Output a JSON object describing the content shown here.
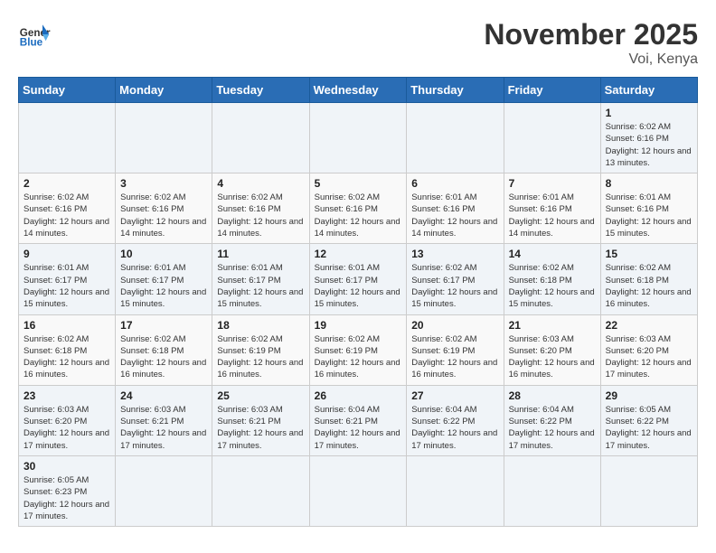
{
  "header": {
    "logo_general": "General",
    "logo_blue": "Blue",
    "month_title": "November 2025",
    "location": "Voi, Kenya"
  },
  "days_of_week": [
    "Sunday",
    "Monday",
    "Tuesday",
    "Wednesday",
    "Thursday",
    "Friday",
    "Saturday"
  ],
  "weeks": [
    [
      {
        "day": "",
        "info": ""
      },
      {
        "day": "",
        "info": ""
      },
      {
        "day": "",
        "info": ""
      },
      {
        "day": "",
        "info": ""
      },
      {
        "day": "",
        "info": ""
      },
      {
        "day": "",
        "info": ""
      },
      {
        "day": "1",
        "info": "Sunrise: 6:02 AM\nSunset: 6:16 PM\nDaylight: 12 hours and 13 minutes."
      }
    ],
    [
      {
        "day": "2",
        "info": "Sunrise: 6:02 AM\nSunset: 6:16 PM\nDaylight: 12 hours and 14 minutes."
      },
      {
        "day": "3",
        "info": "Sunrise: 6:02 AM\nSunset: 6:16 PM\nDaylight: 12 hours and 14 minutes."
      },
      {
        "day": "4",
        "info": "Sunrise: 6:02 AM\nSunset: 6:16 PM\nDaylight: 12 hours and 14 minutes."
      },
      {
        "day": "5",
        "info": "Sunrise: 6:02 AM\nSunset: 6:16 PM\nDaylight: 12 hours and 14 minutes."
      },
      {
        "day": "6",
        "info": "Sunrise: 6:01 AM\nSunset: 6:16 PM\nDaylight: 12 hours and 14 minutes."
      },
      {
        "day": "7",
        "info": "Sunrise: 6:01 AM\nSunset: 6:16 PM\nDaylight: 12 hours and 14 minutes."
      },
      {
        "day": "8",
        "info": "Sunrise: 6:01 AM\nSunset: 6:16 PM\nDaylight: 12 hours and 15 minutes."
      }
    ],
    [
      {
        "day": "9",
        "info": "Sunrise: 6:01 AM\nSunset: 6:17 PM\nDaylight: 12 hours and 15 minutes."
      },
      {
        "day": "10",
        "info": "Sunrise: 6:01 AM\nSunset: 6:17 PM\nDaylight: 12 hours and 15 minutes."
      },
      {
        "day": "11",
        "info": "Sunrise: 6:01 AM\nSunset: 6:17 PM\nDaylight: 12 hours and 15 minutes."
      },
      {
        "day": "12",
        "info": "Sunrise: 6:01 AM\nSunset: 6:17 PM\nDaylight: 12 hours and 15 minutes."
      },
      {
        "day": "13",
        "info": "Sunrise: 6:02 AM\nSunset: 6:17 PM\nDaylight: 12 hours and 15 minutes."
      },
      {
        "day": "14",
        "info": "Sunrise: 6:02 AM\nSunset: 6:18 PM\nDaylight: 12 hours and 15 minutes."
      },
      {
        "day": "15",
        "info": "Sunrise: 6:02 AM\nSunset: 6:18 PM\nDaylight: 12 hours and 16 minutes."
      }
    ],
    [
      {
        "day": "16",
        "info": "Sunrise: 6:02 AM\nSunset: 6:18 PM\nDaylight: 12 hours and 16 minutes."
      },
      {
        "day": "17",
        "info": "Sunrise: 6:02 AM\nSunset: 6:18 PM\nDaylight: 12 hours and 16 minutes."
      },
      {
        "day": "18",
        "info": "Sunrise: 6:02 AM\nSunset: 6:19 PM\nDaylight: 12 hours and 16 minutes."
      },
      {
        "day": "19",
        "info": "Sunrise: 6:02 AM\nSunset: 6:19 PM\nDaylight: 12 hours and 16 minutes."
      },
      {
        "day": "20",
        "info": "Sunrise: 6:02 AM\nSunset: 6:19 PM\nDaylight: 12 hours and 16 minutes."
      },
      {
        "day": "21",
        "info": "Sunrise: 6:03 AM\nSunset: 6:20 PM\nDaylight: 12 hours and 16 minutes."
      },
      {
        "day": "22",
        "info": "Sunrise: 6:03 AM\nSunset: 6:20 PM\nDaylight: 12 hours and 17 minutes."
      }
    ],
    [
      {
        "day": "23",
        "info": "Sunrise: 6:03 AM\nSunset: 6:20 PM\nDaylight: 12 hours and 17 minutes."
      },
      {
        "day": "24",
        "info": "Sunrise: 6:03 AM\nSunset: 6:21 PM\nDaylight: 12 hours and 17 minutes."
      },
      {
        "day": "25",
        "info": "Sunrise: 6:03 AM\nSunset: 6:21 PM\nDaylight: 12 hours and 17 minutes."
      },
      {
        "day": "26",
        "info": "Sunrise: 6:04 AM\nSunset: 6:21 PM\nDaylight: 12 hours and 17 minutes."
      },
      {
        "day": "27",
        "info": "Sunrise: 6:04 AM\nSunset: 6:22 PM\nDaylight: 12 hours and 17 minutes."
      },
      {
        "day": "28",
        "info": "Sunrise: 6:04 AM\nSunset: 6:22 PM\nDaylight: 12 hours and 17 minutes."
      },
      {
        "day": "29",
        "info": "Sunrise: 6:05 AM\nSunset: 6:22 PM\nDaylight: 12 hours and 17 minutes."
      }
    ],
    [
      {
        "day": "30",
        "info": "Sunrise: 6:05 AM\nSunset: 6:23 PM\nDaylight: 12 hours and 17 minutes."
      },
      {
        "day": "",
        "info": ""
      },
      {
        "day": "",
        "info": ""
      },
      {
        "day": "",
        "info": ""
      },
      {
        "day": "",
        "info": ""
      },
      {
        "day": "",
        "info": ""
      },
      {
        "day": "",
        "info": ""
      }
    ]
  ]
}
